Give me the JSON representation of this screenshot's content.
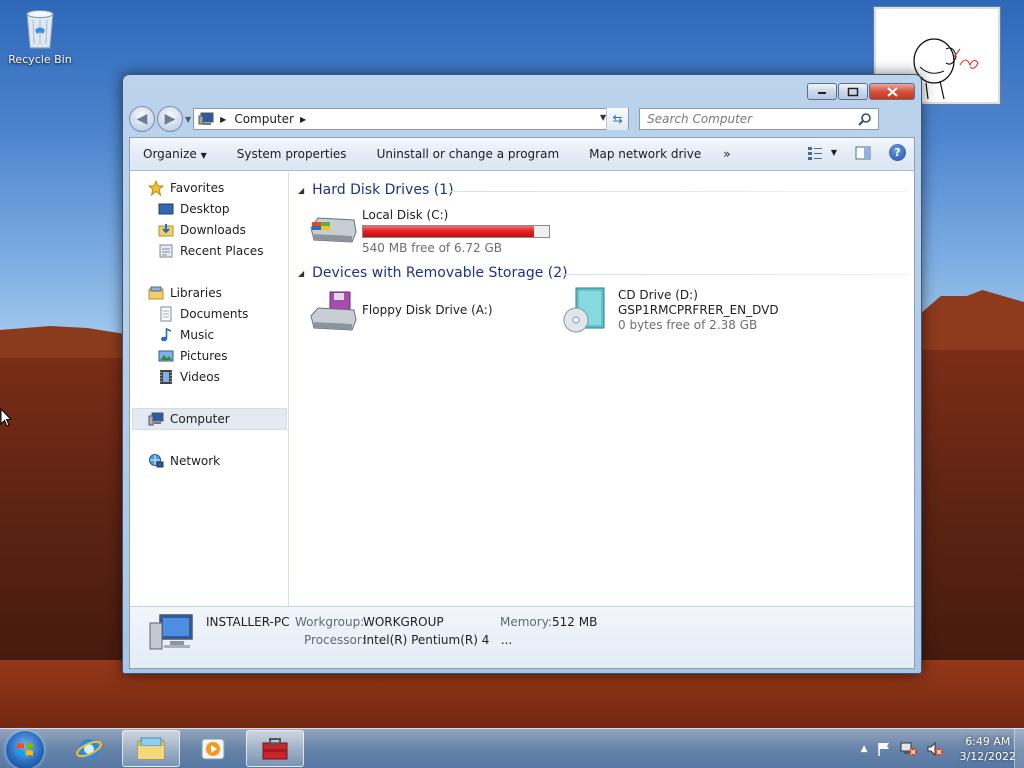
{
  "desktop": {
    "recycle_bin_label": "Recycle Bin"
  },
  "window": {
    "title": "Computer",
    "address": {
      "path": [
        "Computer"
      ]
    },
    "search": {
      "placeholder": "Search Computer"
    },
    "toolbar": {
      "organize": "Organize",
      "system_properties": "System properties",
      "uninstall": "Uninstall or change a program",
      "map_drive": "Map network drive",
      "more": "»"
    },
    "nav": {
      "favorites": "Favorites",
      "desktop": "Desktop",
      "downloads": "Downloads",
      "recent": "Recent Places",
      "libraries": "Libraries",
      "documents": "Documents",
      "music": "Music",
      "pictures": "Pictures",
      "videos": "Videos",
      "computer": "Computer",
      "network": "Network"
    },
    "groups": {
      "hdd": {
        "title": "Hard Disk Drives (1)",
        "drives": [
          {
            "name": "Local Disk (C:)",
            "free": "540 MB free of 6.72 GB",
            "used_fraction": 0.92
          }
        ]
      },
      "removable": {
        "title": "Devices with Removable Storage (2)",
        "floppy": {
          "name": "Floppy Disk Drive (A:)"
        },
        "cd": {
          "name": "CD Drive (D:)",
          "label": "GSP1RMCPRFRER_EN_DVD",
          "free": "0 bytes free of 2.38 GB"
        }
      }
    },
    "details": {
      "computer_name": "INSTALLER-PC",
      "workgroup_label": "Workgroup:",
      "workgroup": "WORKGROUP",
      "memory_label": "Memory:",
      "memory": "512 MB",
      "processor_label": "Processor:",
      "processor": "Intel(R) Pentium(R) 4   ..."
    }
  },
  "taskbar": {
    "time": "6:49 AM",
    "date": "3/12/2022"
  },
  "colors": {
    "group_header": "#1e3287",
    "disk_bar_fill": "#e21e1e",
    "taskbar": "#6e96c3"
  }
}
